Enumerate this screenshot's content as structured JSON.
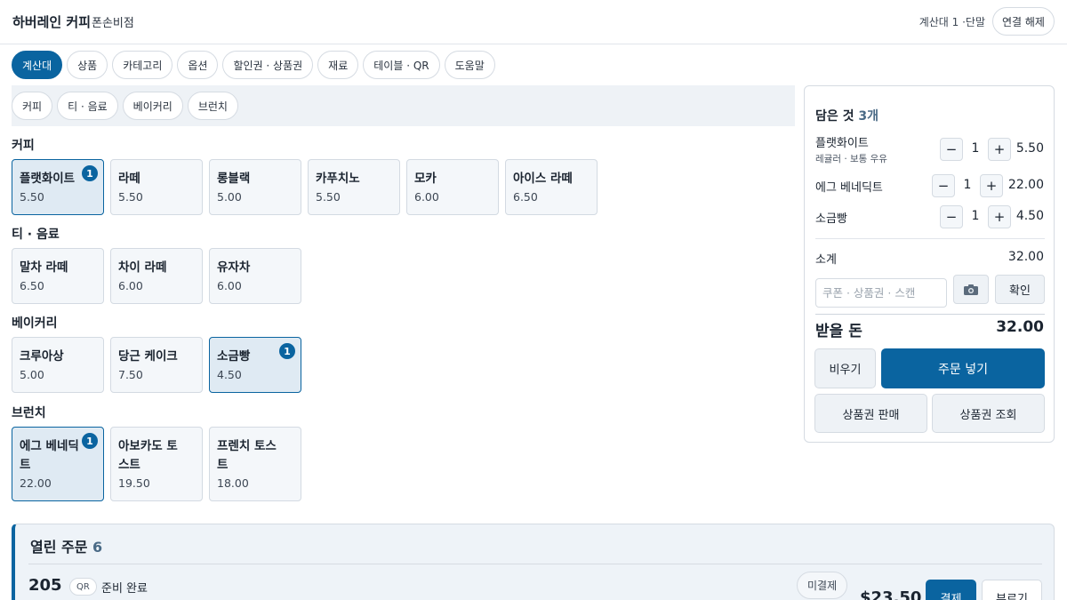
{
  "header": {
    "brand": "하버레인 커피",
    "branch": "폰손비점",
    "device": "계산대 1 ·단말",
    "disconnect": "연결 해제"
  },
  "tabs": [
    {
      "label": "계산대",
      "active": true
    },
    {
      "label": "상품"
    },
    {
      "label": "카테고리"
    },
    {
      "label": "옵션"
    },
    {
      "label": "할인권 · 상품권"
    },
    {
      "label": "재료"
    },
    {
      "label": "테이블 · QR"
    },
    {
      "label": "도움말"
    }
  ],
  "categories": [
    "커피",
    "티 · 음료",
    "베이커리",
    "브런치"
  ],
  "menu": {
    "coffee": {
      "title": "커피",
      "items": [
        {
          "name": "플랫화이트",
          "price": "5.50",
          "count": "1"
        },
        {
          "name": "라떼",
          "price": "5.50"
        },
        {
          "name": "롱블랙",
          "price": "5.00"
        },
        {
          "name": "카푸치노",
          "price": "5.50"
        },
        {
          "name": "모카",
          "price": "6.00"
        },
        {
          "name": "아이스 라떼",
          "price": "6.50"
        }
      ]
    },
    "tea": {
      "title": "티 · 음료",
      "items": [
        {
          "name": "말차 라떼",
          "price": "6.50"
        },
        {
          "name": "차이 라떼",
          "price": "6.00"
        },
        {
          "name": "유자차",
          "price": "6.00"
        }
      ]
    },
    "bakery": {
      "title": "베이커리",
      "items": [
        {
          "name": "크루아상",
          "price": "5.00"
        },
        {
          "name": "당근 케이크",
          "price": "7.50"
        },
        {
          "name": "소금빵",
          "price": "4.50",
          "count": "1"
        }
      ]
    },
    "brunch": {
      "title": "브런치",
      "items": [
        {
          "name": "에그 베네딕트",
          "price": "22.00",
          "count": "1"
        },
        {
          "name": "아보카도 토스트",
          "price": "19.50"
        },
        {
          "name": "프렌치 토스트",
          "price": "18.00"
        }
      ]
    }
  },
  "cart": {
    "title": "담은 것",
    "count": "3개",
    "lines": [
      {
        "name": "플랫화이트",
        "sub": "레귤러 · 보통 우유",
        "qty": "1",
        "price": "5.50"
      },
      {
        "name": "에그 베네딕트",
        "qty": "1",
        "price": "22.00"
      },
      {
        "name": "소금빵",
        "qty": "1",
        "price": "4.50"
      }
    ],
    "minus": "−",
    "plus": "+",
    "subtotal_label": "소계",
    "subtotal": "32.00",
    "coupon_placeholder": "쿠폰 · 상품권 · 스캔",
    "confirm": "확인",
    "due_label": "받을 돈",
    "due": "32.00",
    "clear": "비우기",
    "place_order": "주문 넣기",
    "sell_gift": "상품권 판매",
    "check_gift": "상품권 조회"
  },
  "orders": {
    "title": "열린 주문",
    "count": "6",
    "first": {
      "number": "205",
      "tag": "QR",
      "status": "준비 완료",
      "payment": "미결제",
      "amount": "$23.50",
      "pay": "결제",
      "call": "부르기"
    }
  }
}
